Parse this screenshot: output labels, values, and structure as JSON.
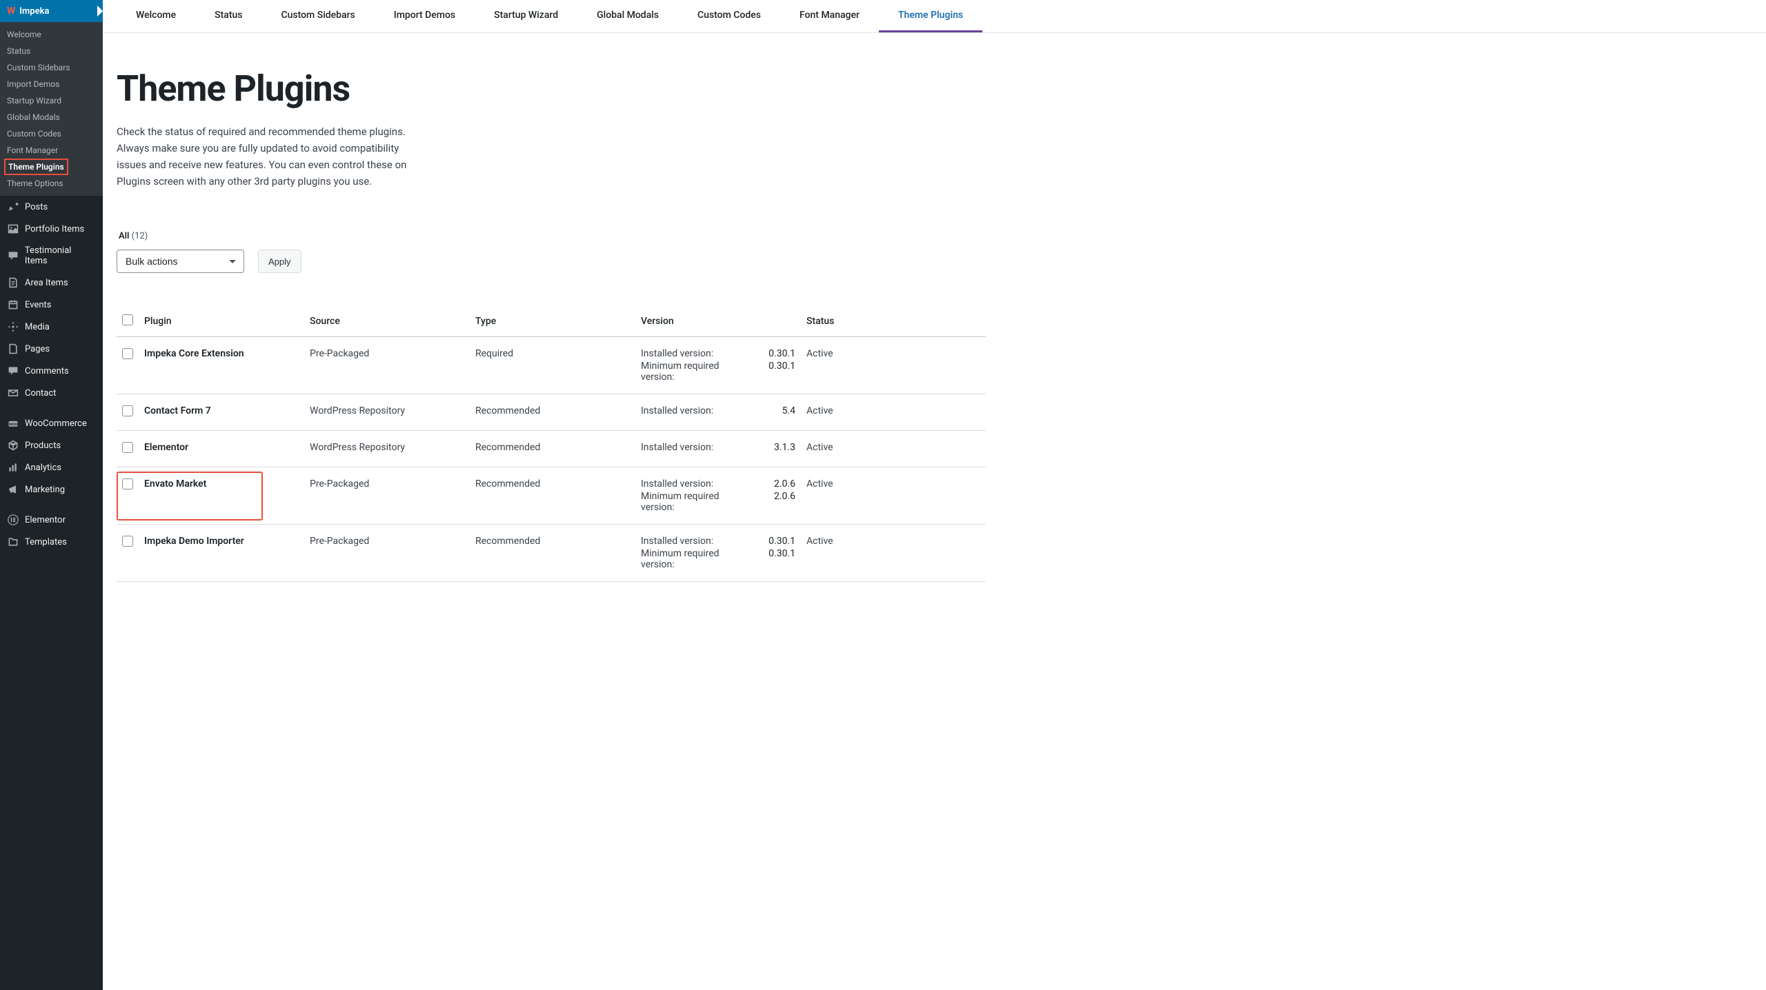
{
  "sidebar": {
    "brand": "Impeka",
    "submenu": [
      "Welcome",
      "Status",
      "Custom Sidebars",
      "Import Demos",
      "Startup Wizard",
      "Global Modals",
      "Custom Codes",
      "Font Manager",
      "Theme Plugins",
      "Theme Options"
    ],
    "active_submenu": "Theme Plugins",
    "main_items": [
      {
        "id": "posts",
        "label": "Posts",
        "icon": "📌"
      },
      {
        "id": "portfolio",
        "label": "Portfolio Items",
        "icon": "🖼"
      },
      {
        "id": "testimonial",
        "label": "Testimonial Items",
        "icon": "💬"
      },
      {
        "id": "area",
        "label": "Area Items",
        "icon": "📄"
      },
      {
        "id": "events",
        "label": "Events",
        "icon": "📅"
      },
      {
        "id": "media",
        "label": "Media",
        "icon": "🎬"
      },
      {
        "id": "pages",
        "label": "Pages",
        "icon": "📄"
      },
      {
        "id": "comments",
        "label": "Comments",
        "icon": "💬"
      },
      {
        "id": "contact",
        "label": "Contact",
        "icon": "✉"
      },
      {
        "id": "woocommerce",
        "label": "WooCommerce",
        "icon": "🛒"
      },
      {
        "id": "products",
        "label": "Products",
        "icon": "📦"
      },
      {
        "id": "analytics",
        "label": "Analytics",
        "icon": "📊"
      },
      {
        "id": "marketing",
        "label": "Marketing",
        "icon": "📣"
      },
      {
        "id": "elementor",
        "label": "Elementor",
        "icon": "Ⓔ"
      },
      {
        "id": "templates",
        "label": "Templates",
        "icon": "📁"
      }
    ],
    "separators_after": [
      "contact",
      "marketing"
    ]
  },
  "top_tabs": [
    "Welcome",
    "Status",
    "Custom Sidebars",
    "Import Demos",
    "Startup Wizard",
    "Global Modals",
    "Custom Codes",
    "Font Manager",
    "Theme Plugins"
  ],
  "active_tab": "Theme Plugins",
  "page": {
    "title": "Theme Plugins",
    "description": "Check the status of required and recommended theme plugins. Always make sure you are fully updated to avoid compatibility issues and receive new features. You can even control these on Plugins screen with any other 3rd party plugins you use."
  },
  "filter": {
    "all_label": "All",
    "count": "(12)"
  },
  "bulk": {
    "select": "Bulk actions",
    "apply": "Apply"
  },
  "table": {
    "headers": {
      "plugin": "Plugin",
      "source": "Source",
      "type": "Type",
      "version": "Version",
      "status": "Status"
    },
    "version_labels": {
      "installed": "Installed version:",
      "minimum": "Minimum required version:"
    },
    "rows": [
      {
        "plugin": "Impeka Core Extension",
        "source": "Pre-Packaged",
        "type": "Required",
        "installed": "0.30.1",
        "minimum": "0.30.1",
        "status": "Active",
        "highlighted": false
      },
      {
        "plugin": "Contact Form 7",
        "source": "WordPress Repository",
        "type": "Recommended",
        "installed": "5.4",
        "minimum": null,
        "status": "Active",
        "highlighted": false
      },
      {
        "plugin": "Elementor",
        "source": "WordPress Repository",
        "type": "Recommended",
        "installed": "3.1.3",
        "minimum": null,
        "status": "Active",
        "highlighted": false
      },
      {
        "plugin": "Envato Market",
        "source": "Pre-Packaged",
        "type": "Recommended",
        "installed": "2.0.6",
        "minimum": "2.0.6",
        "status": "Active",
        "highlighted": true
      },
      {
        "plugin": "Impeka Demo Importer",
        "source": "Pre-Packaged",
        "type": "Recommended",
        "installed": "0.30.1",
        "minimum": "0.30.1",
        "status": "Active",
        "highlighted": false
      }
    ]
  }
}
